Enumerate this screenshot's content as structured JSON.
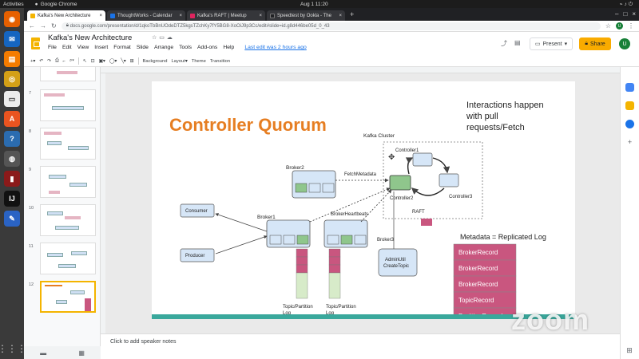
{
  "system": {
    "activities": "Activities",
    "app_name": "Google Chrome",
    "clock": "Aug 1  11:20"
  },
  "browser": {
    "tabs": [
      {
        "label": "Kafka's New Architecture",
        "color": "#f4b400",
        "active": true
      },
      {
        "label": "ThoughtWorks - Calendar",
        "color": "#1a73e8",
        "active": false
      },
      {
        "label": "Kafka's RAFT | Meetup",
        "color": "#e0245e",
        "active": false
      },
      {
        "label": "Speedtest by Ookla - The",
        "color": "#202124",
        "active": false
      }
    ],
    "new_tab": "+",
    "url": "docs.google.com/presentation/d/1qkoTbBnUOdeDTZ5kgsTZchKy7fY5BG8-XoOiJ9p3Cc/edit#slide=id.g8d446be05d_0_43"
  },
  "docs": {
    "title": "Kafka's New Architecture",
    "menus": [
      "File",
      "Edit",
      "View",
      "Insert",
      "Format",
      "Slide",
      "Arrange",
      "Tools",
      "Add-ons",
      "Help"
    ],
    "last_edit": "Last edit was 2 hours ago",
    "present_label": "Present",
    "share_label": "Share",
    "user_initial": "U"
  },
  "toolbar": {
    "background": "Background",
    "layout": "Layout",
    "theme": "Theme",
    "transition": "Transition"
  },
  "thumbnails": {
    "numbers": [
      "7",
      "8",
      "9",
      "10",
      "11",
      "12"
    ],
    "selected": "12"
  },
  "slide": {
    "title": "Controller Quorum",
    "title_color": "#e67e22",
    "intro": [
      "Interactions happen",
      "with pull",
      "requests/Fetch"
    ],
    "cluster_label": "Kafka Cluster",
    "controller1": "Controller1",
    "controller2": "Controller2",
    "controller3": "Controller3",
    "raft": "RAFT",
    "broker1": "Broker1",
    "broker2": "Broker2",
    "broker3": "Broker3",
    "fetch_metadata": "FetchMetadata",
    "broker_heartbeats": "BrokerHeartbeats",
    "consumer": "Consumer",
    "producer": "Producer",
    "admin_util": [
      "AdminUtil",
      "CreateTopic"
    ],
    "partition_log": [
      "Topic/Partition",
      "Log"
    ],
    "metadata_title": "Metadata = Replicated Log",
    "metadata_records": [
      "BrokerRecord",
      "BrokerRecord",
      "BrokerRecord",
      "TopicRecord",
      "PartitionRecord"
    ],
    "log_color": "#c9567f",
    "node_fill": "#d6e6f7",
    "green_fill": "#8fc68c"
  },
  "notes_placeholder": "Click to add speaker notes",
  "watermark": "zoom"
}
